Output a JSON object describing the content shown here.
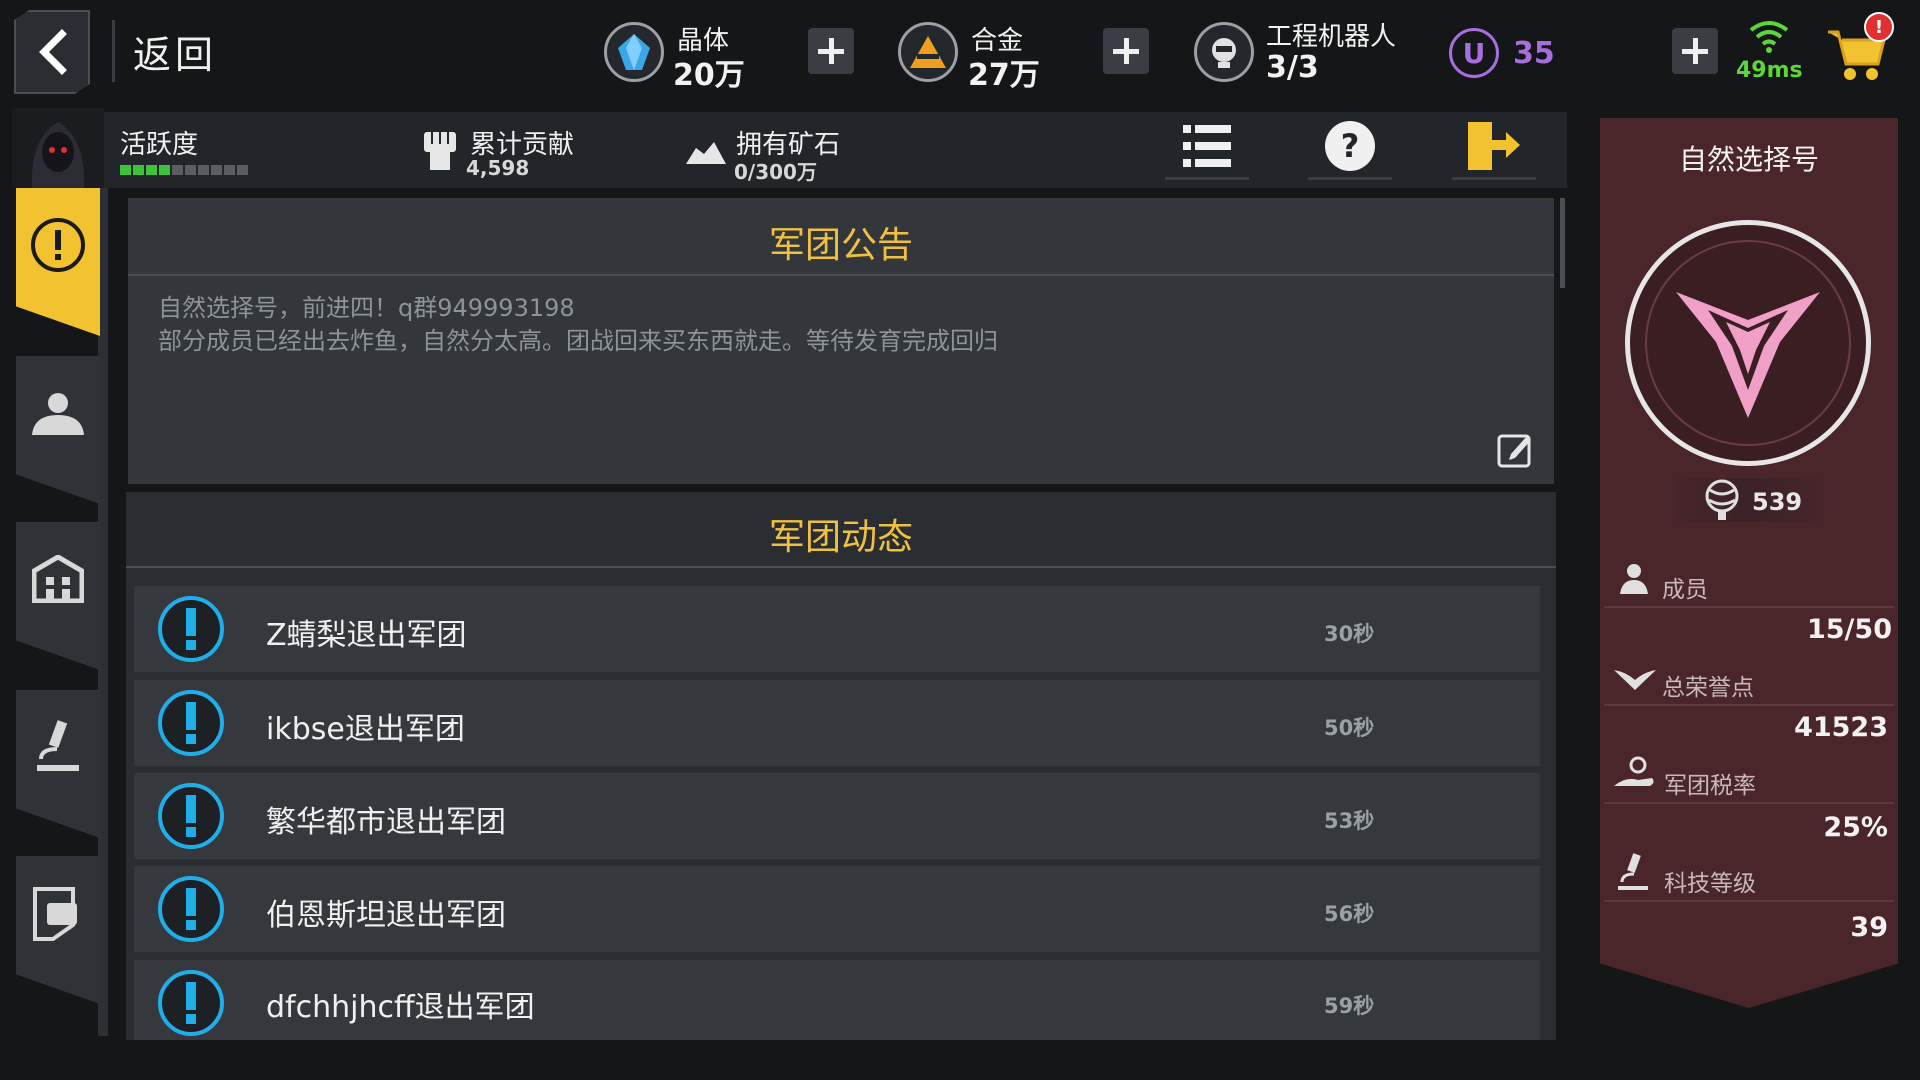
{
  "topbar": {
    "back_label": "返回",
    "crystal": {
      "name": "晶体",
      "value": "20万"
    },
    "alloy": {
      "name": "合金",
      "value": "27万"
    },
    "robot": {
      "name": "工程机器人",
      "value": "3/3"
    },
    "u_currency": {
      "letter": "U",
      "value": "35"
    },
    "ping": "49ms",
    "cart_badge": "!"
  },
  "stats": {
    "activity_label": "活跃度",
    "activity_level": 0.4,
    "contribution_label": "累计贡献",
    "contribution_value": "4,598",
    "ore_label": "拥有矿石",
    "ore_value": "0/300万"
  },
  "announcement": {
    "title": "军团公告",
    "lines": [
      "自然选择号，前进四！q群949993198",
      "部分成员已经出去炸鱼，自然分太高。团战回来买东西就走。等待发育完成回归"
    ]
  },
  "feed": {
    "title": "军团动态",
    "rows": [
      {
        "name": "Z蜻梨退出军团",
        "time": "30秒"
      },
      {
        "name": "ikbse退出军团",
        "time": "50秒"
      },
      {
        "name": "繁华都市退出军团",
        "time": "53秒"
      },
      {
        "name": "伯恩斯坦退出军团",
        "time": "56秒"
      },
      {
        "name": "dfchhjhcff退出军团",
        "time": "59秒"
      }
    ]
  },
  "guild": {
    "name": "自然选择号",
    "score": "539",
    "members_label": "成员",
    "members_value": "15/50",
    "honor_label": "总荣誉点",
    "honor_value": "41523",
    "tax_label": "军团税率",
    "tax_value": "25%",
    "tech_label": "科技等级",
    "tech_value": "39"
  },
  "colors": {
    "accent_yellow": "#f2c230",
    "title_gold": "#f0c040",
    "info_blue": "#1faee8",
    "guild_panel": "#4a262b",
    "u_purple": "#a86ee0",
    "ping_green": "#5cd63a"
  }
}
